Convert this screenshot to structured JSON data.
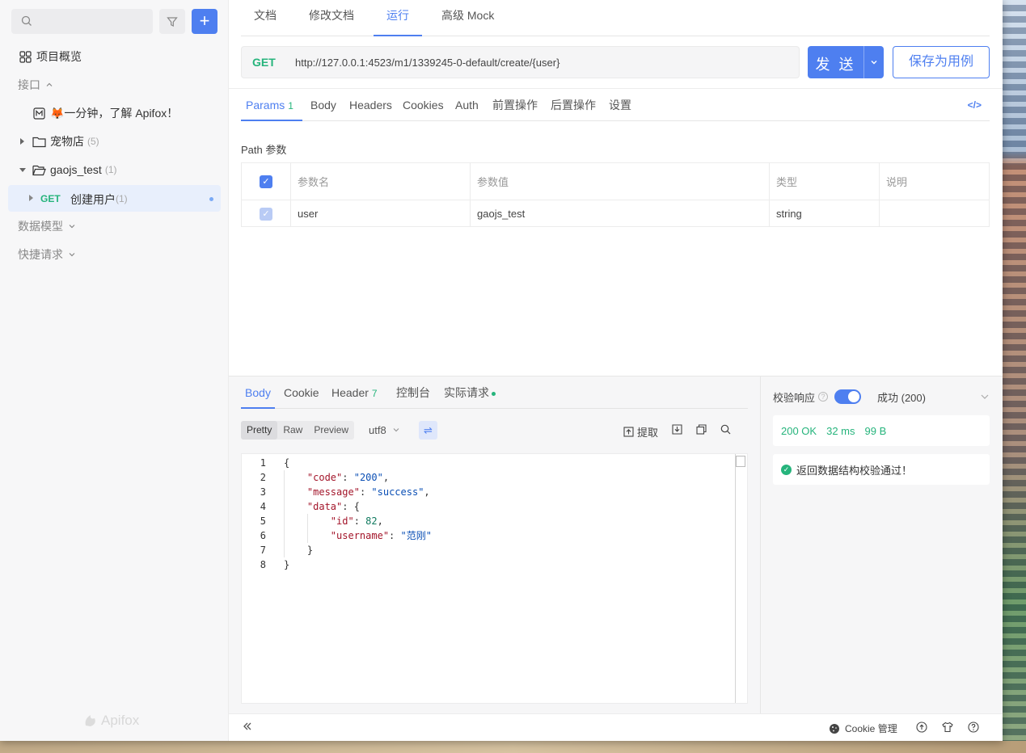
{
  "sidebar": {
    "overview": "项目概览",
    "section_api": "接口",
    "intro_item": "🦊一分钟，了解 Apifox！",
    "folder_petshop": "宠物店",
    "folder_petshop_count": "(5)",
    "folder_gaojs": "gaojs_test",
    "folder_gaojs_count": "(1)",
    "api_method": "GET",
    "api_name": "创建用户",
    "api_count": "(1)",
    "section_models": "数据模型",
    "section_quick": "快捷请求",
    "logo_text": "Apifox"
  },
  "top_tabs": [
    "文档",
    "修改文档",
    "运行",
    "高级 Mock"
  ],
  "request": {
    "method": "GET",
    "url": "http://127.0.0.1:4523/m1/1339245-0-default/create/{user}",
    "send_label": "发 送",
    "save_label": "保存为用例"
  },
  "req_tabs": {
    "params": "Params",
    "params_count": "1",
    "body": "Body",
    "headers": "Headers",
    "cookies": "Cookies",
    "auth": "Auth",
    "pre": "前置操作",
    "post": "后置操作",
    "settings": "设置",
    "code_icon": "</>"
  },
  "path_params": {
    "label": "Path 参数",
    "headers": [
      "参数名",
      "参数值",
      "类型",
      "说明"
    ],
    "rows": [
      {
        "name": "user",
        "value": "gaojs_test",
        "type": "string",
        "desc": ""
      }
    ]
  },
  "response": {
    "tabs": {
      "body": "Body",
      "cookie": "Cookie",
      "header": "Header",
      "header_count": "7",
      "console": "控制台",
      "actual": "实际请求"
    },
    "views": [
      "Pretty",
      "Raw",
      "Preview"
    ],
    "encoding": "utf8",
    "extract": "提取",
    "code_lines": [
      {
        "n": "1",
        "parts": [
          [
            "p",
            "{"
          ]
        ]
      },
      {
        "n": "2",
        "parts": [
          [
            "p",
            "    "
          ],
          [
            "k",
            "\"code\""
          ],
          [
            "p",
            ": "
          ],
          [
            "s",
            "\"200\""
          ],
          [
            "p",
            ","
          ]
        ]
      },
      {
        "n": "3",
        "parts": [
          [
            "p",
            "    "
          ],
          [
            "k",
            "\"message\""
          ],
          [
            "p",
            ": "
          ],
          [
            "s",
            "\"success\""
          ],
          [
            "p",
            ","
          ]
        ]
      },
      {
        "n": "4",
        "parts": [
          [
            "p",
            "    "
          ],
          [
            "k",
            "\"data\""
          ],
          [
            "p",
            ": {"
          ]
        ]
      },
      {
        "n": "5",
        "parts": [
          [
            "p",
            "        "
          ],
          [
            "k",
            "\"id\""
          ],
          [
            "p",
            ": "
          ],
          [
            "n",
            "82"
          ],
          [
            "p",
            ","
          ]
        ]
      },
      {
        "n": "6",
        "parts": [
          [
            "p",
            "        "
          ],
          [
            "k",
            "\"username\""
          ],
          [
            "p",
            ": "
          ],
          [
            "s",
            "\"范刚\""
          ]
        ]
      },
      {
        "n": "7",
        "parts": [
          [
            "p",
            "    }"
          ]
        ]
      },
      {
        "n": "8",
        "parts": [
          [
            "p",
            "}"
          ]
        ]
      }
    ]
  },
  "validation": {
    "label": "校验响应",
    "result": "成功 (200)",
    "status": "200 OK",
    "time": "32 ms",
    "size": "99 B",
    "message": "返回数据结构校验通过！"
  },
  "status_bar": {
    "cookie_label": "Cookie 管理"
  },
  "colors": {
    "accent": "#4e7ff0",
    "success": "#26b47c"
  }
}
